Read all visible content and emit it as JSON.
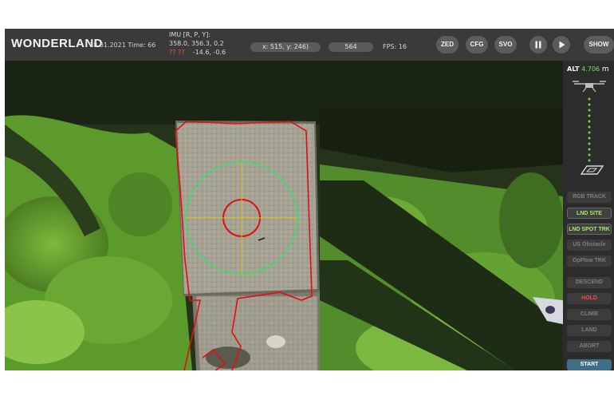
{
  "header": {
    "logo": "WONDERLAND",
    "date_time": "18.01.2021 Time: 66",
    "imu_label": "IMU [R, P, Y]:",
    "imu_line1": "358.0, 356.3, 0.2",
    "imu_line2_label": "?? ??",
    "imu_line2_value": "-14.6, -0.6",
    "coords": "x: 515, y: 246)",
    "counter": "564",
    "fps": "FPS: 16",
    "buttons": {
      "zed": "ZED",
      "cfg": "CFG",
      "svo": "SVO",
      "show": "SHOW"
    }
  },
  "panel": {
    "alt_label": "ALT",
    "alt_value": "4.706",
    "alt_unit": "m",
    "modes": [
      "RGB TRACK",
      "LND SITE",
      "LND SPOT TRK",
      "US Obstacle",
      "OpFlow TRK"
    ],
    "commands": [
      "DESCEND",
      "HOLD",
      "CLIMB",
      "LAND",
      "ABORT"
    ],
    "start": "START"
  },
  "colors": {
    "active_green": "#a8e86a",
    "hold_red": "#ff4a4a",
    "start_blue": "#3f6f86",
    "alt_green": "#6fe06f",
    "contour_red": "#e01010",
    "target_green": "#3fdc6a",
    "crosshair_yellow": "#d8c020"
  },
  "icons": [
    "pause-icon",
    "play-icon",
    "drone-icon",
    "landing-pad-icon"
  ]
}
